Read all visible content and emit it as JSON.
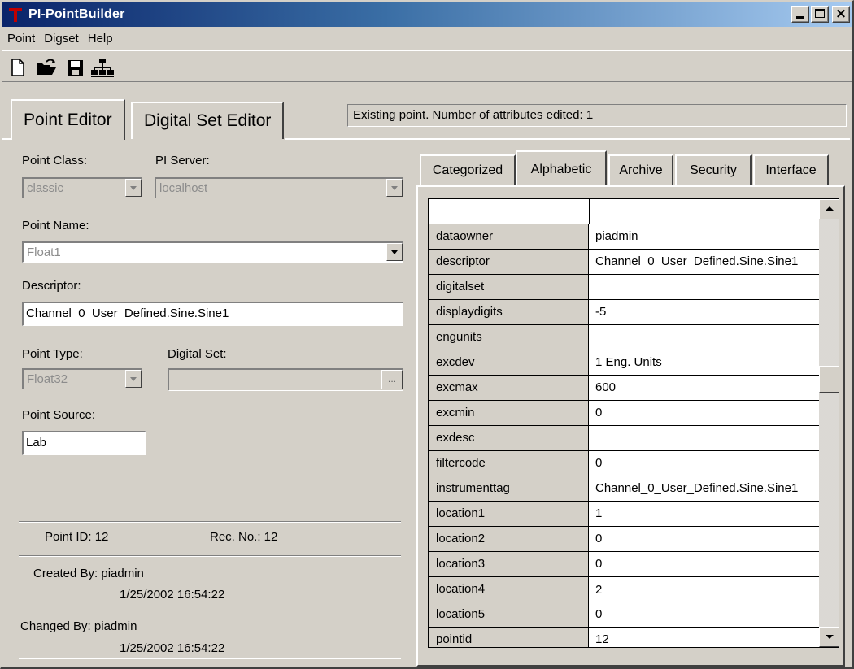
{
  "window": {
    "title": "PI-PointBuilder"
  },
  "menu": [
    "Point",
    "Digset",
    "Help"
  ],
  "toolbar": {
    "icons": [
      "new-document-icon",
      "open-folder-icon",
      "save-icon",
      "network-icon"
    ]
  },
  "main_tabs": [
    {
      "label": "Point Editor",
      "active": true
    },
    {
      "label": "Digital Set Editor",
      "active": false
    }
  ],
  "status_text": "Existing point.  Number of attributes edited: 1",
  "form": {
    "point_class_label": "Point Class:",
    "point_class_value": "classic",
    "pi_server_label": "PI Server:",
    "pi_server_value": "localhost",
    "point_name_label": "Point Name:",
    "point_name_value": "Float1",
    "descriptor_label": "Descriptor:",
    "descriptor_value": "Channel_0_User_Defined.Sine.Sine1",
    "point_type_label": "Point Type:",
    "point_type_value": "Float32",
    "digital_set_label": "Digital Set:",
    "digital_set_value": "",
    "digital_set_button": "...",
    "point_source_label": "Point Source:",
    "point_source_value": "Lab"
  },
  "info": {
    "point_id": "Point ID: 12",
    "rec_no": "Rec. No.: 12",
    "created_by": "Created By: piadmin",
    "created_date": "1/25/2002 16:54:22",
    "changed_by": "Changed By: piadmin",
    "changed_date": "1/25/2002 16:54:22"
  },
  "attr_tabs": [
    {
      "label": "Categorized",
      "active": false
    },
    {
      "label": "Alphabetic",
      "active": true
    },
    {
      "label": "Archive",
      "active": false
    },
    {
      "label": "Security",
      "active": false
    },
    {
      "label": "Interface",
      "active": false
    }
  ],
  "attributes": [
    {
      "name": "dataowner",
      "value": "piadmin"
    },
    {
      "name": "descriptor",
      "value": "Channel_0_User_Defined.Sine.Sine1"
    },
    {
      "name": "digitalset",
      "value": ""
    },
    {
      "name": "displaydigits",
      "value": "-5"
    },
    {
      "name": "engunits",
      "value": ""
    },
    {
      "name": "excdev",
      "value": "1  Eng. Units"
    },
    {
      "name": "excmax",
      "value": "600"
    },
    {
      "name": "excmin",
      "value": "0"
    },
    {
      "name": "exdesc",
      "value": ""
    },
    {
      "name": "filtercode",
      "value": "0"
    },
    {
      "name": "instrumenttag",
      "value": "Channel_0_User_Defined.Sine.Sine1"
    },
    {
      "name": "location1",
      "value": "1"
    },
    {
      "name": "location2",
      "value": "0"
    },
    {
      "name": "location3",
      "value": "0"
    },
    {
      "name": "location4",
      "value": "2",
      "editing": true
    },
    {
      "name": "location5",
      "value": "0"
    },
    {
      "name": "pointid",
      "value": "12"
    }
  ]
}
